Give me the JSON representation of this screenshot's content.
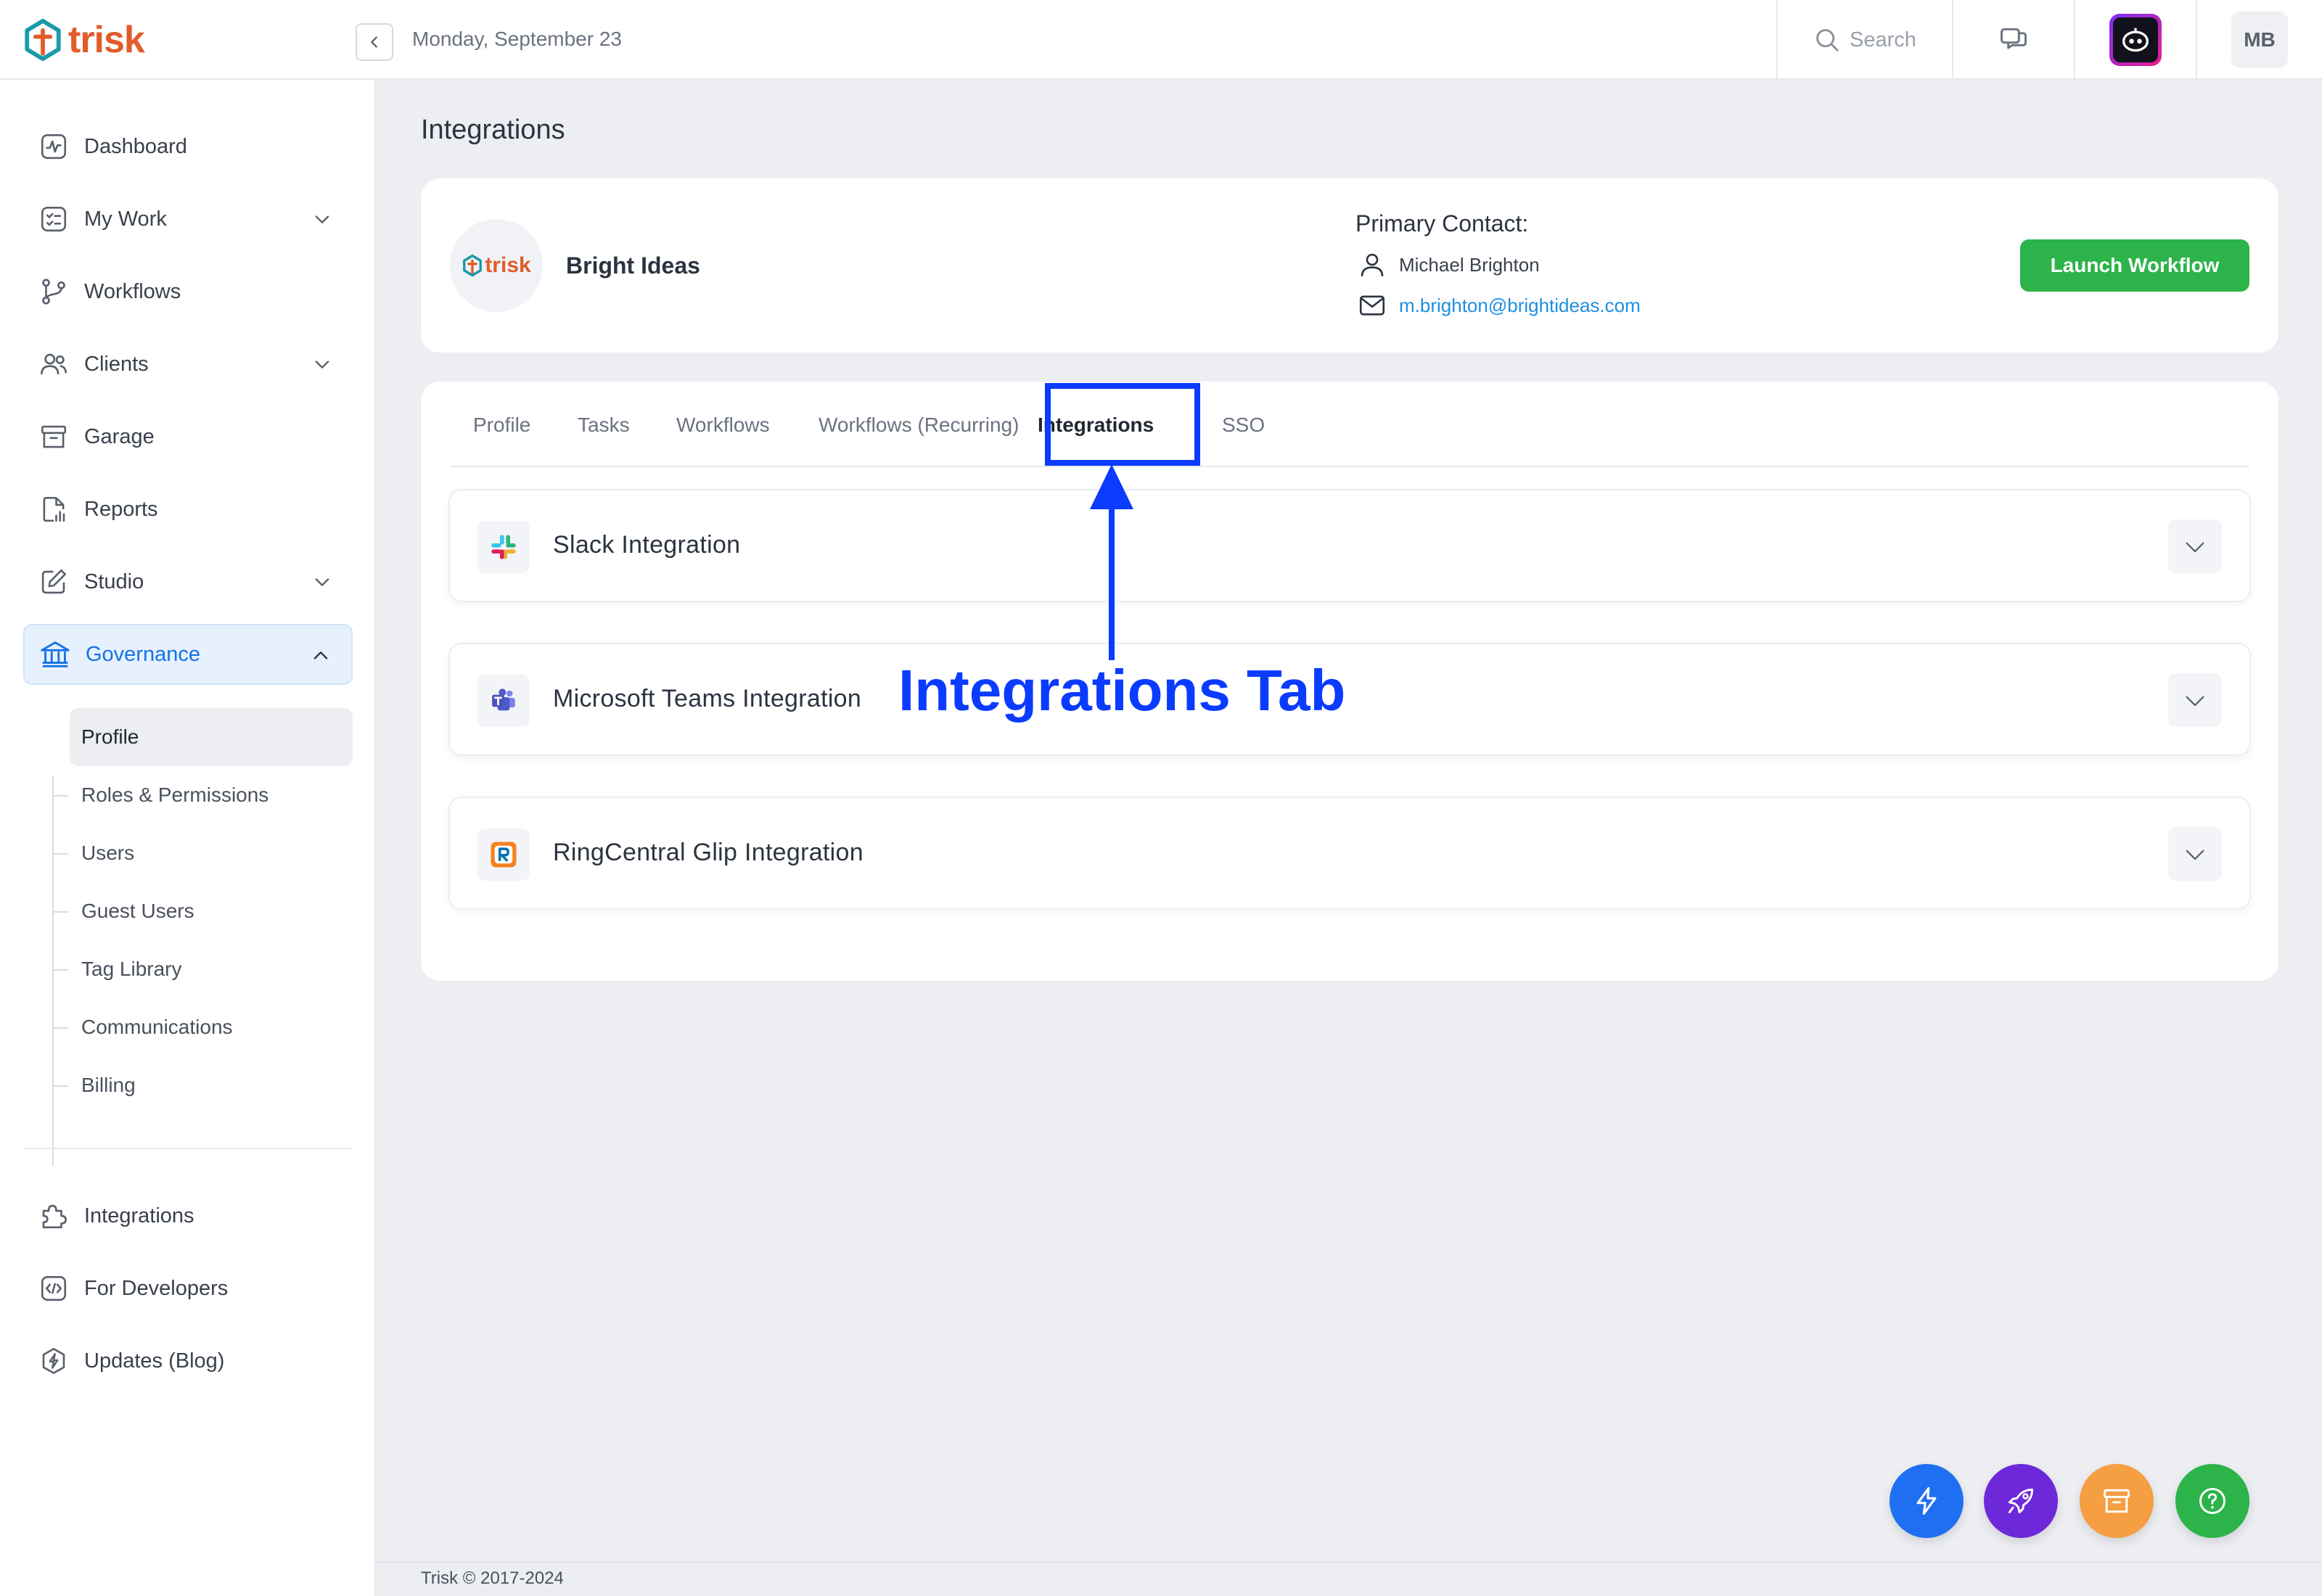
{
  "app": {
    "logo_text": "trisk"
  },
  "topbar": {
    "date": "Monday, September 23",
    "search_label": "Search",
    "user_initials": "MB"
  },
  "sidebar": {
    "items": [
      {
        "label": "Dashboard",
        "icon": "dashboard-icon"
      },
      {
        "label": "My Work",
        "icon": "checklist-icon",
        "expandable": true
      },
      {
        "label": "Workflows",
        "icon": "workflow-branch-icon"
      },
      {
        "label": "Clients",
        "icon": "users-icon",
        "expandable": true
      },
      {
        "label": "Garage",
        "icon": "archive-box-icon"
      },
      {
        "label": "Reports",
        "icon": "report-document-icon"
      },
      {
        "label": "Studio",
        "icon": "edit-pencil-icon",
        "expandable": true
      },
      {
        "label": "Governance",
        "icon": "bank-icon",
        "expanded": true,
        "active": true
      }
    ],
    "governance_sub": [
      {
        "label": "Profile",
        "active": true
      },
      {
        "label": "Roles & Permissions"
      },
      {
        "label": "Users"
      },
      {
        "label": "Guest Users"
      },
      {
        "label": "Tag Library"
      },
      {
        "label": "Communications"
      },
      {
        "label": "Billing"
      }
    ],
    "bottom_items": [
      {
        "label": "Integrations",
        "icon": "puzzle-icon"
      },
      {
        "label": "For Developers",
        "icon": "code-icon"
      },
      {
        "label": "Updates (Blog)",
        "icon": "lightning-badge-icon"
      }
    ]
  },
  "main": {
    "page_title": "Integrations",
    "org": {
      "logo_text": "trisk",
      "name": "Bright Ideas",
      "contact_title": "Primary Contact:",
      "contact_name": "Michael Brighton",
      "contact_email": "m.brighton@brightideas.com",
      "launch_label": "Launch Workflow"
    },
    "tabs": [
      {
        "label": "Profile"
      },
      {
        "label": "Tasks"
      },
      {
        "label": "Workflows"
      },
      {
        "label": "Workflows (Recurring)"
      },
      {
        "label": "Integrations",
        "active": true
      },
      {
        "label": "SSO"
      }
    ],
    "integrations": [
      {
        "label": "Slack Integration",
        "icon": "slack-icon"
      },
      {
        "label": "Microsoft Teams Integration",
        "icon": "teams-icon"
      },
      {
        "label": "RingCentral Glip Integration",
        "icon": "ringcentral-icon"
      }
    ],
    "annotation": "Integrations Tab"
  },
  "footer": {
    "copyright": "Trisk © 2017-2024"
  },
  "colors": {
    "accent": "#1473e6",
    "launch": "#2cb34a",
    "annotation": "#0a3bff",
    "logo": "#e25c2a"
  },
  "fabs": [
    {
      "icon": "lightning-icon",
      "color": "#1f6ff2"
    },
    {
      "icon": "rocket-icon",
      "color": "#6d28d9"
    },
    {
      "icon": "archive-icon",
      "color": "#f59e42"
    },
    {
      "icon": "help-icon",
      "color": "#2cb34a"
    }
  ]
}
